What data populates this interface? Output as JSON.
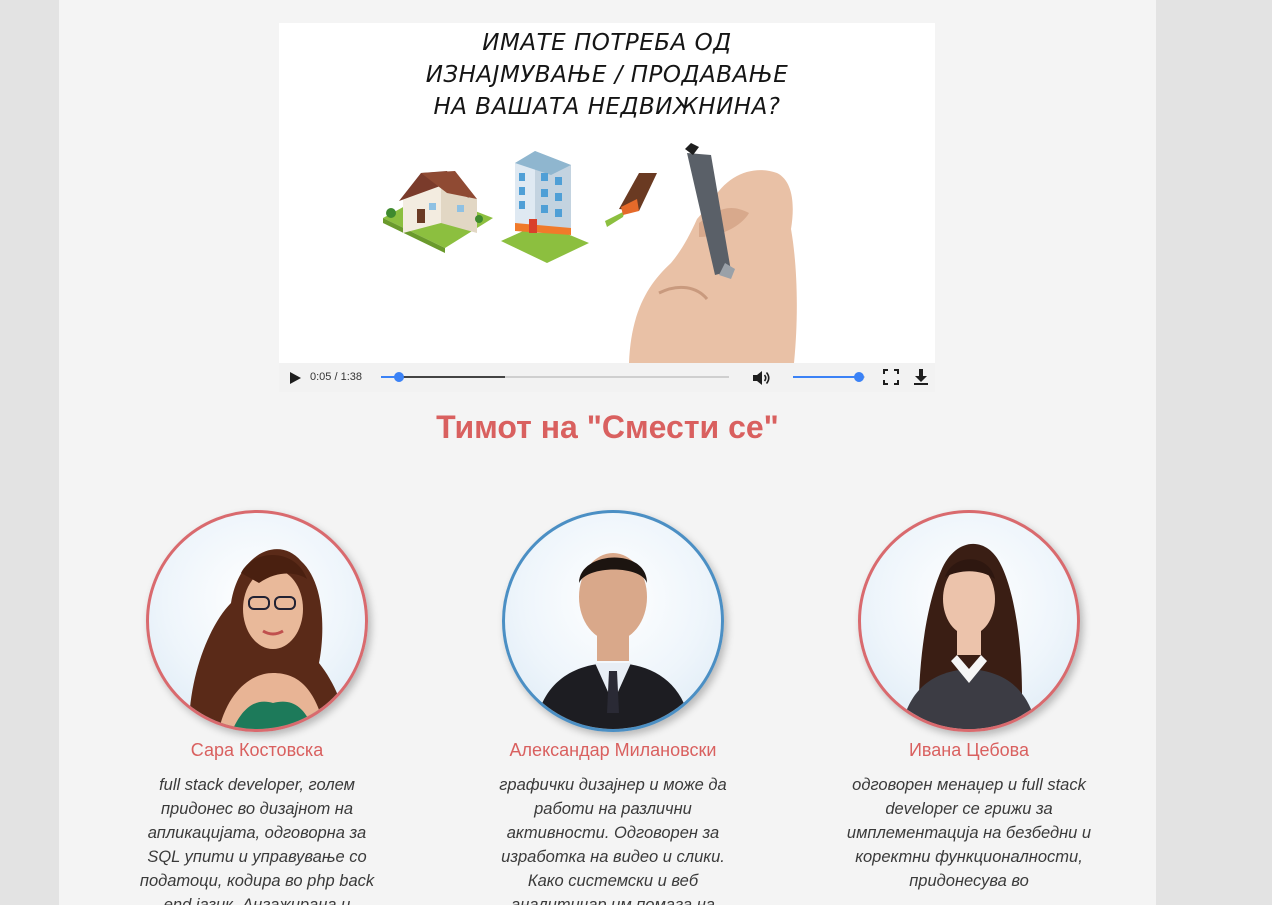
{
  "video": {
    "headline": [
      "ИМАТЕ ПОТРЕБА ОД",
      "ИЗНАЈМУВАЊЕ / ПРОДАВАЊЕ",
      "НА ВАШАТА НЕДВИЖНИНА?"
    ],
    "time_display": "0:05 / 1:38",
    "progress_fraction": 0.051,
    "buffered_fraction": 0.355,
    "volume_fraction": 0.92,
    "accent_color": "#3b82f6"
  },
  "team": {
    "title": "Тимот на \"Смести се\"",
    "members": [
      {
        "name": "Сара Костовска",
        "bio": "full stack developer, голем придонес во дизајнот на апликацијата, одговорна за SQL упити и управување со податоци, кодира во php back end јазик. Ангажирана и",
        "border_color": "#d96a6e"
      },
      {
        "name": "Александар Милановски",
        "bio": "графички дизајнер и може да работи на различни активности. Одговорен за изработка на видео и слики. Како системски и веб аналитичар им помага на",
        "border_color": "#4b8fc4"
      },
      {
        "name": "Ивана Цебова",
        "bio": "одговорен менаџер и full stack developer се грижи за имплементација на безбедни и коректни функционалности, придонесува во",
        "border_color": "#d96a6e"
      }
    ]
  },
  "colors": {
    "page_bg": "#f4f4f4",
    "outer_bg": "#e3e3e3",
    "heading": "#d9605f"
  }
}
